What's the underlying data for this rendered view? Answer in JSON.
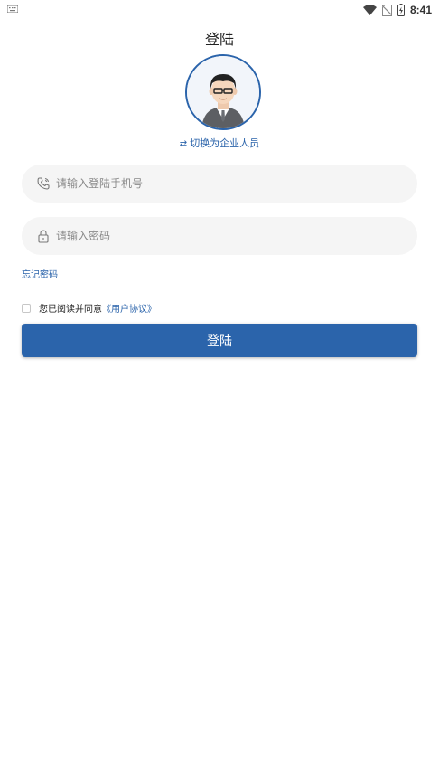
{
  "status_bar": {
    "time": "8:41",
    "icons": [
      "keyboard-icon",
      "wifi-icon",
      "no-sim-icon",
      "battery-charging-icon"
    ]
  },
  "header": {
    "title": "登陆"
  },
  "avatar": {
    "icon": "user-avatar-icon"
  },
  "switch_role": {
    "icon": "swap-arrows-icon",
    "label": "切换为企业人员"
  },
  "form": {
    "phone": {
      "icon": "phone-icon",
      "placeholder": "请输入登陆手机号",
      "value": ""
    },
    "password": {
      "icon": "lock-icon",
      "placeholder": "请输入密码",
      "value": ""
    },
    "forgot_label": "忘记密码",
    "agreement": {
      "checked": false,
      "text": "您已阅读并同意",
      "link": "《用户协议》"
    },
    "submit_label": "登陆"
  },
  "colors": {
    "accent": "#2b64ab",
    "field_bg": "#f5f5f5"
  }
}
